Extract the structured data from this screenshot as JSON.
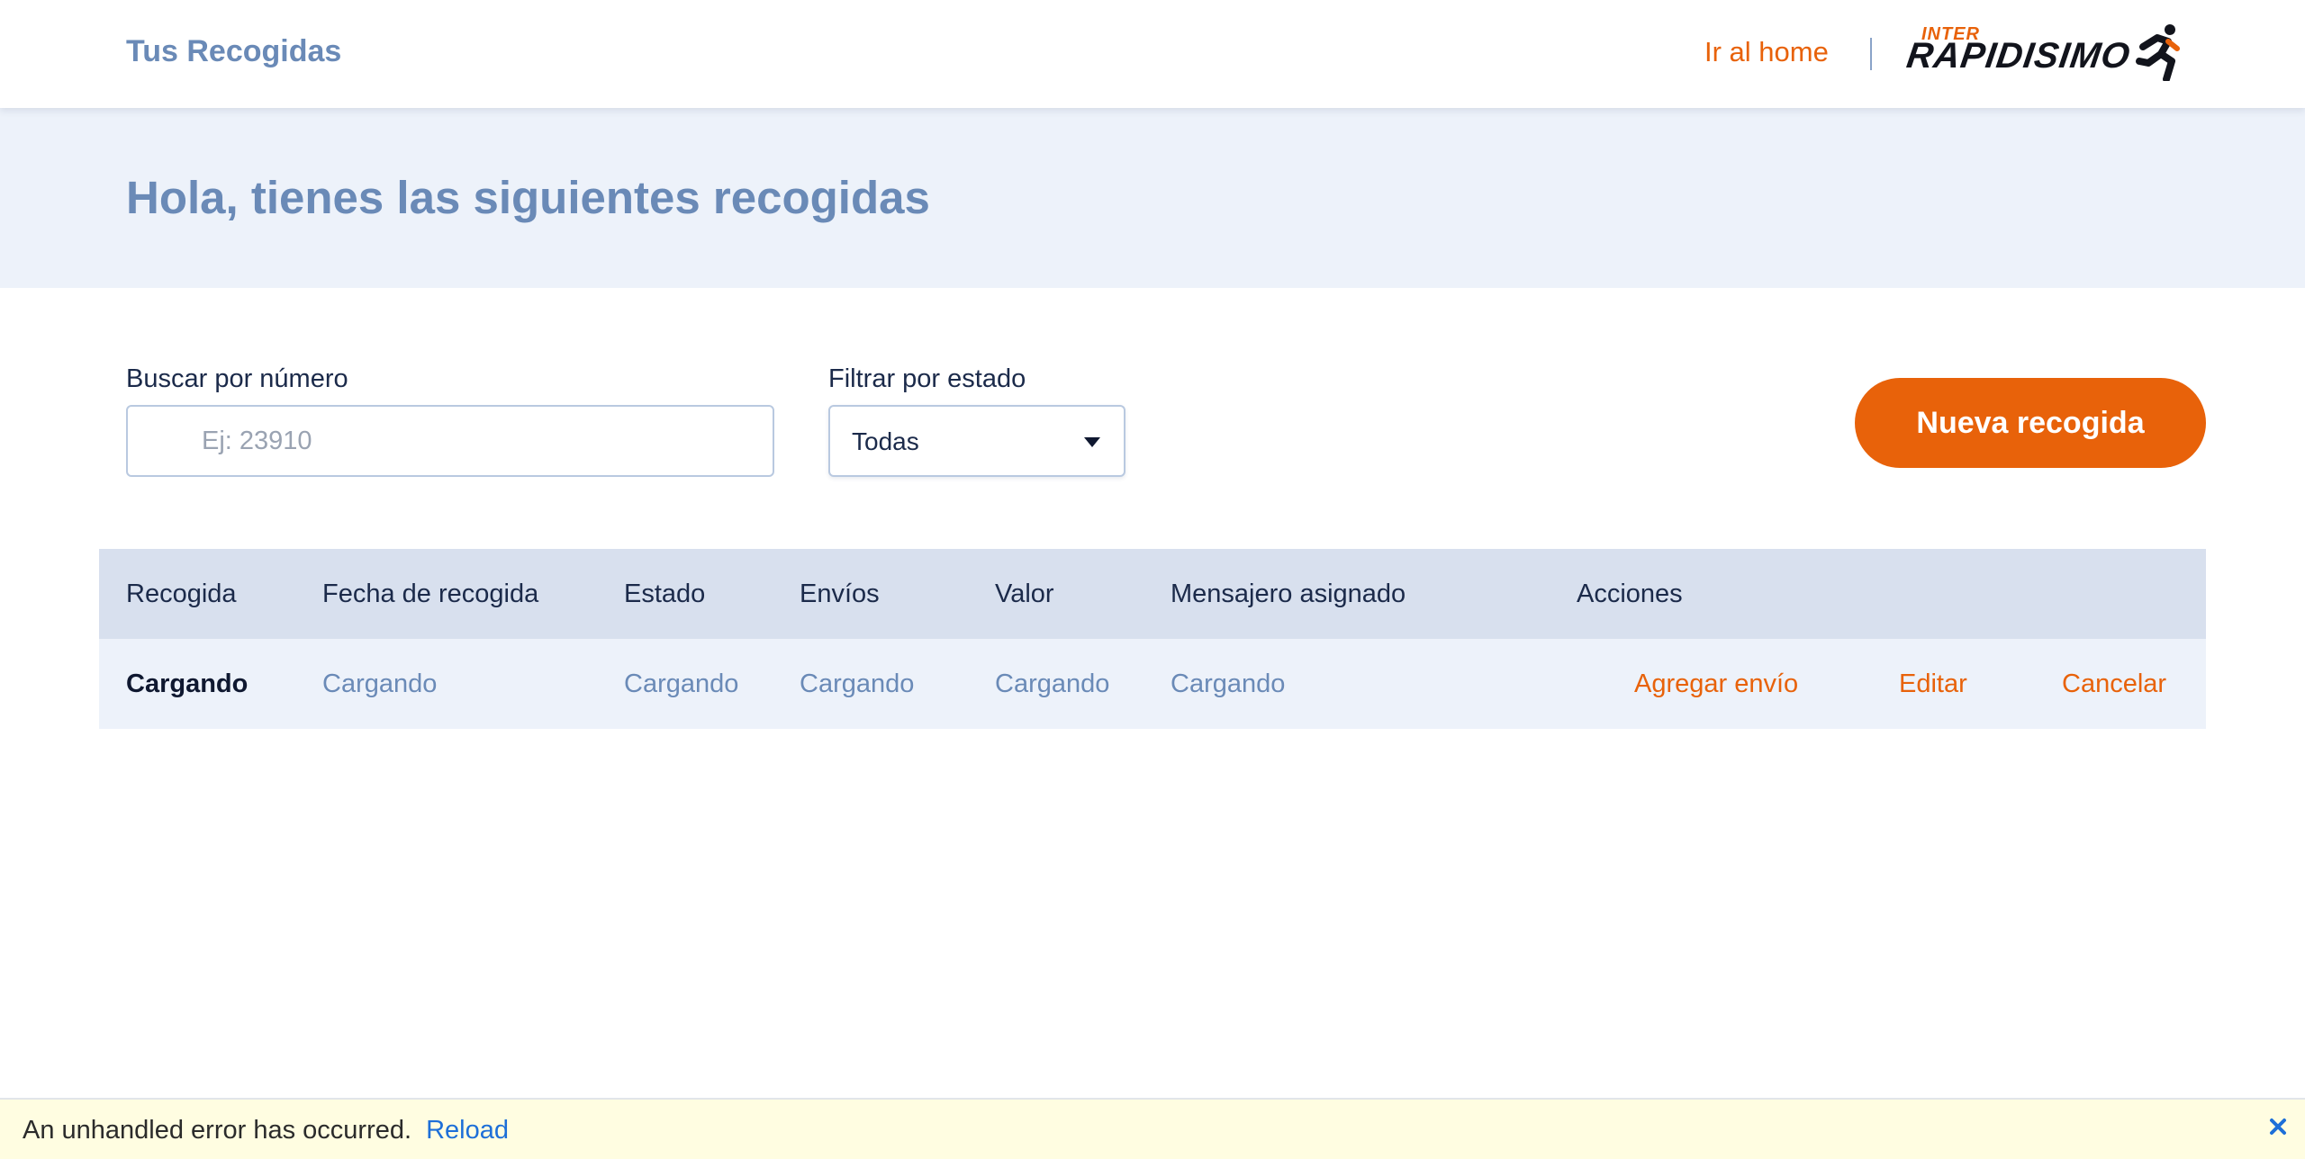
{
  "header": {
    "title": "Tus Recogidas",
    "home_link": "Ir al home",
    "logo": {
      "small_text": "INTER",
      "main_text": "RAPIDISIMO",
      "icon": "runner-icon"
    }
  },
  "hero": {
    "heading": "Hola, tienes las siguientes recogidas"
  },
  "filters": {
    "search": {
      "label": "Buscar por número",
      "placeholder": "Ej: 23910",
      "value": ""
    },
    "status": {
      "label": "Filtrar por estado",
      "selected": "Todas"
    },
    "new_button": "Nueva recogida"
  },
  "table": {
    "columns": [
      "Recogida",
      "Fecha de recogida",
      "Estado",
      "Envíos",
      "Valor",
      "Mensajero asignado",
      "Acciones"
    ],
    "rows": [
      {
        "recogida": "Cargando",
        "fecha": "Cargando",
        "estado": "Cargando",
        "envios": "Cargando",
        "valor": "Cargando",
        "mensajero": "Cargando",
        "actions": [
          "Agregar envío",
          "Editar",
          "Cancelar"
        ]
      }
    ]
  },
  "error_banner": {
    "message": "An unhandled error has occurred.",
    "reload": "Reload",
    "close_icon": "close-icon"
  },
  "colors": {
    "accent": "#e8620a",
    "title_blue": "#6a8ab7",
    "hero_bg": "#edf2fa",
    "table_header_bg": "#d8e0ee",
    "error_bg": "#fffde1",
    "link_blue": "#1d6fd8"
  }
}
